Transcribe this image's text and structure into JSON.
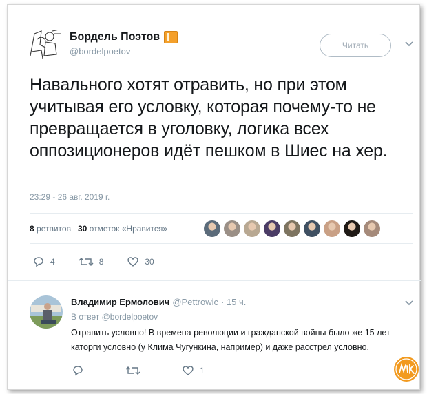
{
  "tweet": {
    "author_name": "Бордель Поэтов",
    "author_handle": "@bordelpoetov",
    "follow_label": "Читать",
    "text": "Навального хотят отравить, но при этом учитывая его условку, которая почему-то не превращается в уголовку, логика всех оппозиционеров идёт пешком в Шиес на хер.",
    "timestamp": "23:29 - 26 авг. 2019 г.",
    "retweets_count": "8",
    "retweets_label": "ретвитов",
    "likes_count": "30",
    "likes_label": "отметок «Нравится»",
    "actions": {
      "reply_count": "4",
      "retweet_count": "8",
      "like_count": "30"
    }
  },
  "likers": [
    {
      "name": "liker-1",
      "color": "#5b6b7a"
    },
    {
      "name": "liker-2",
      "color": "#9a8f86"
    },
    {
      "name": "liker-3",
      "color": "#b8a892"
    },
    {
      "name": "liker-4",
      "color": "#4b3c66"
    },
    {
      "name": "liker-5",
      "color": "#7d7460"
    },
    {
      "name": "liker-6",
      "color": "#3f5062"
    },
    {
      "name": "liker-7",
      "color": "#c9a085"
    },
    {
      "name": "liker-8",
      "color": "#1f1a16"
    },
    {
      "name": "liker-9",
      "color": "#a58a7a"
    }
  ],
  "reply": {
    "author_name": "Владимир Ермолович",
    "author_handle": "@Pettrowic",
    "time": "· 15 ч.",
    "in_reply_prefix": "В ответ",
    "in_reply_handle": "@bordelpoetov",
    "text": "Отравить условно! В времена революции и гражданской войны было же 15 лет каторги условно (у Клима Чугункина, например) и даже расстрел условно.",
    "actions": {
      "reply_count": "",
      "retweet_count": "",
      "like_count": "1"
    }
  },
  "colors": {
    "accent": "#1da1f2",
    "muted": "#657786",
    "text": "#14171a"
  }
}
